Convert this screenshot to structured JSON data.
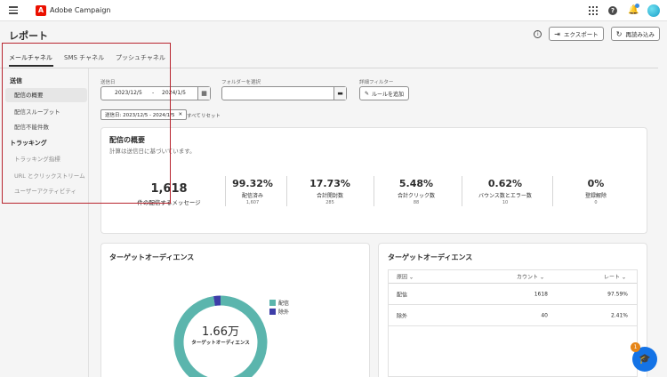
{
  "app": {
    "title": "Adobe Campaign"
  },
  "page": {
    "title": "レポート"
  },
  "actions": {
    "export": "エクスポート",
    "reload": "再読み込み"
  },
  "tabs": [
    {
      "label": "メールチャネル",
      "active": true
    },
    {
      "label": "SMS チャネル",
      "active": false
    },
    {
      "label": "プッシュチャネル",
      "active": false
    }
  ],
  "sidebar": {
    "sections": [
      {
        "title": "送信",
        "items": [
          {
            "label": "配信の概要",
            "active": true
          },
          {
            "label": "配信スループット",
            "active": false
          },
          {
            "label": "配信不能件数",
            "active": false
          }
        ]
      },
      {
        "title": "トラッキング",
        "items": [
          {
            "label": "トラッキング指標",
            "active": false
          },
          {
            "label": "URL とクリックストリーム",
            "active": false
          },
          {
            "label": "ユーザーアクティビティ",
            "active": false
          }
        ]
      }
    ]
  },
  "filters": {
    "date_label": "送信日",
    "date_from": "2023/12/5",
    "date_sep": "-",
    "date_to": "2024/1/5",
    "folder_label": "フォルダーを選択",
    "advanced_label": "詳細フィルター",
    "add_rule": "ルールを追加",
    "chip": "送信日: 2023/12/5 - 2024/1/5",
    "reset": "すべてリセット"
  },
  "summary": {
    "title": "配信の概要",
    "subtitle": "計算は送信日に基づいています。",
    "kpis": [
      {
        "value": "1,618",
        "label": "件の配信するメッセージ",
        "sub": ""
      },
      {
        "value": "99.32%",
        "label": "配信済み",
        "sub": "1,607"
      },
      {
        "value": "17.73%",
        "label": "合計開封数",
        "sub": "285"
      },
      {
        "value": "5.48%",
        "label": "合計クリック数",
        "sub": "88"
      },
      {
        "value": "0.62%",
        "label": "バウンス数とエラー数",
        "sub": "10"
      },
      {
        "value": "0%",
        "label": "登録解除",
        "sub": "0"
      }
    ]
  },
  "audience_chart": {
    "title": "ターゲットオーディエンス",
    "center_value": "1.66万",
    "center_label": "ターゲットオーディエンス",
    "colors": {
      "delivered": "#5bb5ad",
      "excluded": "#3d3da8"
    }
  },
  "chart_data": {
    "type": "pie",
    "categories": [
      "配信",
      "除外"
    ],
    "values": [
      1618,
      40
    ],
    "title": "ターゲットオーディエンス"
  },
  "audience_table": {
    "title": "ターゲットオーディエンス",
    "columns": [
      "原因",
      "カウント",
      "レート"
    ],
    "rows": [
      {
        "reason": "配信",
        "count": "1618",
        "rate": "97.59%"
      },
      {
        "reason": "除外",
        "count": "40",
        "rate": "2.41%"
      }
    ]
  },
  "help": {
    "badge": "1"
  }
}
